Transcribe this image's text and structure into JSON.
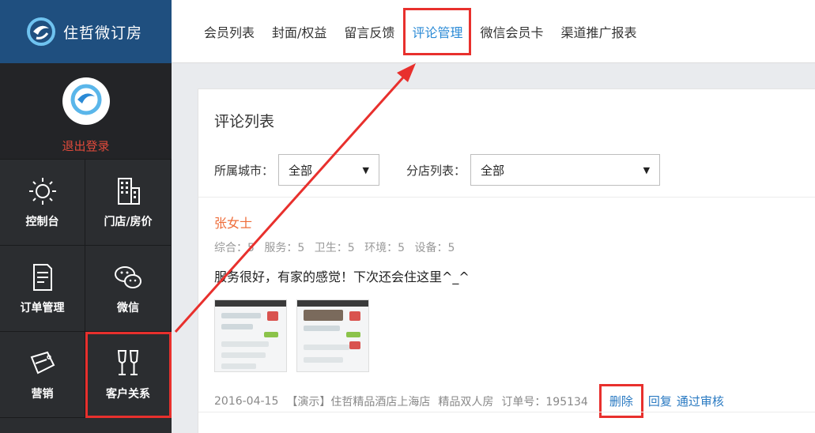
{
  "brand": {
    "name": "住哲微订房"
  },
  "user": {
    "logout_label": "退出登录"
  },
  "nav": [
    {
      "label": "控制台",
      "icon": "sun-icon"
    },
    {
      "label": "门店/房价",
      "icon": "building-icon"
    },
    {
      "label": "订单管理",
      "icon": "document-icon"
    },
    {
      "label": "微信",
      "icon": "wechat-icon"
    },
    {
      "label": "营销",
      "icon": "sale-tag-icon"
    },
    {
      "label": "客户关系",
      "icon": "wine-glasses-icon"
    }
  ],
  "tabs": [
    {
      "label": "会员列表"
    },
    {
      "label": "封面/权益"
    },
    {
      "label": "留言反馈"
    },
    {
      "label": "评论管理"
    },
    {
      "label": "微信会员卡"
    },
    {
      "label": "渠道推广报表"
    }
  ],
  "panel": {
    "title": "评论列表",
    "city_label": "所属城市：",
    "city_value": "全部",
    "branch_label": "分店列表：",
    "branch_value": "全部"
  },
  "review": {
    "reviewer": "张女士",
    "scores": [
      "综合：5",
      "服务：5",
      "卫生：5",
      "环境：5",
      "设备：5"
    ],
    "comment": "服务很好，有家的感觉！下次还会住这里^_^",
    "date": "2016-04-15",
    "hotel": "【演示】住哲精品酒店上海店",
    "room": "精品双人房",
    "order": "订单号：195134",
    "actions": {
      "delete": "删除",
      "reply": "回复",
      "approve": "通过审核"
    }
  },
  "colors": {
    "accent": "#2a8ad6",
    "highlight": "#e8302d",
    "sidebar": "#2b2d30",
    "brand_bg": "#1f4f7f",
    "reviewer": "#ee6d3a"
  }
}
